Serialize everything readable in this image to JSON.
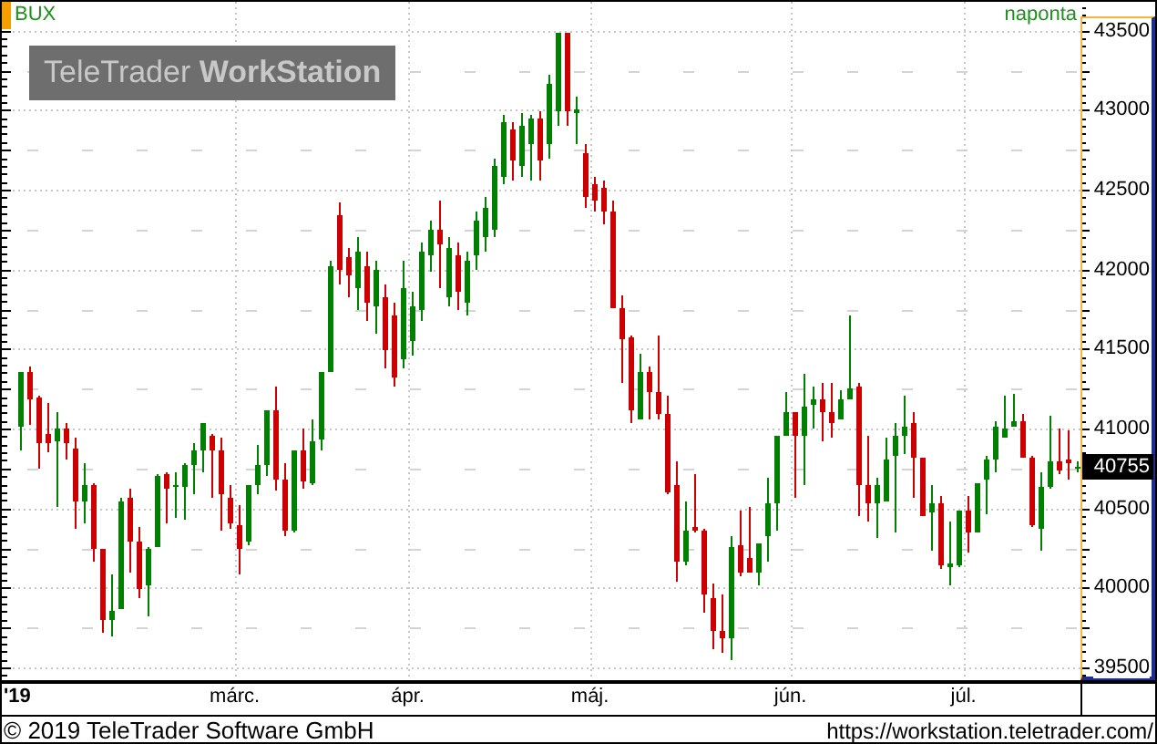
{
  "chart": {
    "symbol": "BUX",
    "interval": "naponta",
    "logo": "TeleTrader **WorkStation**",
    "year_label": "'19",
    "last_price": "40755",
    "chart_data": {
      "type": "candlestick",
      "grid": true,
      "ylim": [
        39420,
        43680
      ],
      "yticks": [
        39500,
        40000,
        40500,
        41000,
        41500,
        42000,
        42500,
        43000,
        43500
      ],
      "categories": [
        null,
        null,
        null,
        null,
        null,
        null,
        null,
        null,
        null,
        null,
        null,
        null,
        null,
        null,
        null,
        null,
        null,
        null,
        null,
        null,
        null,
        null,
        null,
        null,
        "márc.",
        null,
        null,
        null,
        null,
        null,
        null,
        null,
        null,
        null,
        null,
        null,
        null,
        null,
        null,
        null,
        null,
        null,
        null,
        "ápr.",
        null,
        null,
        null,
        null,
        null,
        null,
        null,
        null,
        null,
        null,
        null,
        null,
        null,
        null,
        null,
        null,
        null,
        null,
        null,
        "máj.",
        null,
        null,
        null,
        null,
        null,
        null,
        null,
        null,
        null,
        null,
        null,
        null,
        null,
        null,
        null,
        null,
        null,
        null,
        null,
        null,
        null,
        "jún.",
        null,
        null,
        null,
        null,
        null,
        null,
        null,
        null,
        null,
        null,
        null,
        null,
        null,
        null,
        null,
        null,
        null,
        null,
        "júl.",
        null,
        null,
        null,
        null,
        null,
        null,
        null,
        null,
        null,
        null,
        null,
        null
      ],
      "ohlc": [
        [
          41010,
          41350,
          40860,
          41350
        ],
        [
          41350,
          41390,
          41020,
          41180
        ],
        [
          41190,
          41210,
          40750,
          40910
        ],
        [
          40970,
          41160,
          40850,
          40910
        ],
        [
          40920,
          41100,
          40510,
          41000
        ],
        [
          41000,
          41040,
          40810,
          40910
        ],
        [
          40870,
          40940,
          40370,
          40540
        ],
        [
          40540,
          40780,
          40410,
          40650
        ],
        [
          40650,
          40660,
          40160,
          40250
        ],
        [
          40250,
          40250,
          39720,
          39800
        ],
        [
          39800,
          40080,
          39700,
          39860
        ],
        [
          39870,
          40560,
          39870,
          40540
        ],
        [
          40560,
          40620,
          40100,
          40290
        ],
        [
          40290,
          40380,
          39940,
          39990
        ],
        [
          40010,
          40260,
          39820,
          40250
        ],
        [
          40260,
          40710,
          40260,
          40700
        ],
        [
          40710,
          40720,
          40400,
          40620
        ],
        [
          40630,
          40730,
          40440,
          40640
        ],
        [
          40630,
          40780,
          40430,
          40770
        ],
        [
          40770,
          40910,
          40590,
          40860
        ],
        [
          40860,
          41040,
          40720,
          41030
        ],
        [
          40960,
          40970,
          40570,
          40860
        ],
        [
          40860,
          40940,
          40360,
          40590
        ],
        [
          40570,
          40650,
          40370,
          40400
        ],
        [
          40390,
          40520,
          40080,
          40250
        ],
        [
          40290,
          40650,
          40270,
          40640
        ],
        [
          40650,
          40900,
          40590,
          40770
        ],
        [
          40770,
          41120,
          40700,
          41120
        ],
        [
          41120,
          41260,
          40610,
          40680
        ],
        [
          40680,
          40780,
          40320,
          40360
        ],
        [
          40360,
          40860,
          40350,
          40860
        ],
        [
          40860,
          41000,
          40620,
          40670
        ],
        [
          40660,
          41060,
          40650,
          40920
        ],
        [
          40930,
          41360,
          40860,
          41350
        ],
        [
          41360,
          42050,
          41350,
          42020
        ],
        [
          42340,
          42420,
          41910,
          42000
        ],
        [
          42080,
          42130,
          41830,
          41960
        ],
        [
          41880,
          42200,
          41750,
          42110
        ],
        [
          42020,
          42110,
          41680,
          41790
        ],
        [
          41770,
          42050,
          41600,
          42000
        ],
        [
          41830,
          41910,
          41380,
          41490
        ],
        [
          41710,
          41790,
          41260,
          41320
        ],
        [
          41430,
          42050,
          41380,
          41880
        ],
        [
          41550,
          41860,
          41460,
          41770
        ],
        [
          41750,
          42170,
          41680,
          42110
        ],
        [
          42090,
          42310,
          41990,
          42250
        ],
        [
          42250,
          42430,
          41880,
          42160
        ],
        [
          41830,
          42200,
          41770,
          42130
        ],
        [
          42090,
          42170,
          41750,
          41860
        ],
        [
          41790,
          42110,
          41710,
          42050
        ],
        [
          42090,
          42360,
          42000,
          42310
        ],
        [
          42200,
          42450,
          42110,
          42390
        ],
        [
          42250,
          42700,
          42200,
          42650
        ],
        [
          42580,
          42970,
          42540,
          42920
        ],
        [
          42880,
          42920,
          42560,
          42680
        ],
        [
          42650,
          42980,
          42580,
          42900
        ],
        [
          42790,
          42970,
          42560,
          42950
        ],
        [
          42950,
          42990,
          42560,
          42680
        ],
        [
          42790,
          43220,
          42700,
          43170
        ],
        [
          42990,
          43480,
          42900,
          43480
        ],
        [
          43480,
          43480,
          42900,
          42990
        ],
        [
          42980,
          43090,
          42790,
          43000
        ],
        [
          42730,
          42790,
          42390,
          42450
        ],
        [
          42540,
          42580,
          42360,
          42430
        ],
        [
          42510,
          42560,
          42280,
          42360
        ],
        [
          42360,
          42430,
          41760,
          41760
        ],
        [
          41760,
          41840,
          41290,
          41560
        ],
        [
          41570,
          41580,
          41030,
          41120
        ],
        [
          41060,
          41470,
          41060,
          41360
        ],
        [
          41360,
          41390,
          41060,
          41230
        ],
        [
          41230,
          41590,
          41060,
          41090
        ],
        [
          41090,
          41210,
          40590,
          40600
        ],
        [
          40640,
          40790,
          40040,
          40160
        ],
        [
          40160,
          40540,
          40140,
          40360
        ],
        [
          40380,
          40710,
          40350,
          40360
        ],
        [
          40360,
          40370,
          39840,
          39960
        ],
        [
          39930,
          40030,
          39610,
          39730
        ],
        [
          39730,
          39960,
          39590,
          39680
        ],
        [
          39680,
          40320,
          39550,
          40260
        ],
        [
          40270,
          40480,
          40070,
          40090
        ],
        [
          40190,
          40510,
          40090,
          40100
        ],
        [
          40100,
          40280,
          40010,
          40280
        ],
        [
          40320,
          40690,
          40160,
          40530
        ],
        [
          40530,
          40960,
          40360,
          40960
        ],
        [
          40960,
          41230,
          40960,
          41100
        ],
        [
          41100,
          41100,
          40570,
          40950
        ],
        [
          40950,
          41340,
          40650,
          41140
        ],
        [
          41150,
          41260,
          41000,
          41180
        ],
        [
          41180,
          41290,
          40920,
          41100
        ],
        [
          41100,
          41290,
          40940,
          41040
        ],
        [
          41060,
          41240,
          41060,
          41180
        ],
        [
          41180,
          41710,
          41180,
          41250
        ],
        [
          41260,
          41290,
          40450,
          40640
        ],
        [
          40640,
          40950,
          40420,
          40530
        ],
        [
          40530,
          40690,
          40310,
          40640
        ],
        [
          40540,
          40940,
          40540,
          40810
        ],
        [
          40830,
          41030,
          40350,
          40960
        ],
        [
          40960,
          41210,
          40840,
          41010
        ],
        [
          41030,
          41100,
          40570,
          40820
        ],
        [
          40820,
          40820,
          40450,
          40450
        ],
        [
          40470,
          40640,
          40230,
          40530
        ],
        [
          40530,
          40580,
          40120,
          40140
        ],
        [
          40130,
          40420,
          40010,
          40150
        ],
        [
          40140,
          40490,
          40130,
          40490
        ],
        [
          40490,
          40580,
          40220,
          40350
        ],
        [
          40350,
          40660,
          40350,
          40660
        ],
        [
          40680,
          40830,
          40460,
          40810
        ],
        [
          40810,
          41050,
          40720,
          41010
        ],
        [
          40940,
          41210,
          40940,
          41000
        ],
        [
          41010,
          41220,
          41010,
          41050
        ],
        [
          41050,
          41090,
          40820,
          40820
        ],
        [
          40820,
          40830,
          40380,
          40390
        ],
        [
          40370,
          40730,
          40230,
          40630
        ],
        [
          40630,
          41080,
          40620,
          40790
        ],
        [
          40790,
          41000,
          40710,
          40740
        ],
        [
          40800,
          40990,
          40680,
          40780
        ],
        [
          40745,
          40790,
          40720,
          40755
        ]
      ]
    }
  },
  "footer": {
    "copyright": "© 2019 TeleTrader Software GmbH",
    "url": "https://workstation.teletrader.com/"
  }
}
